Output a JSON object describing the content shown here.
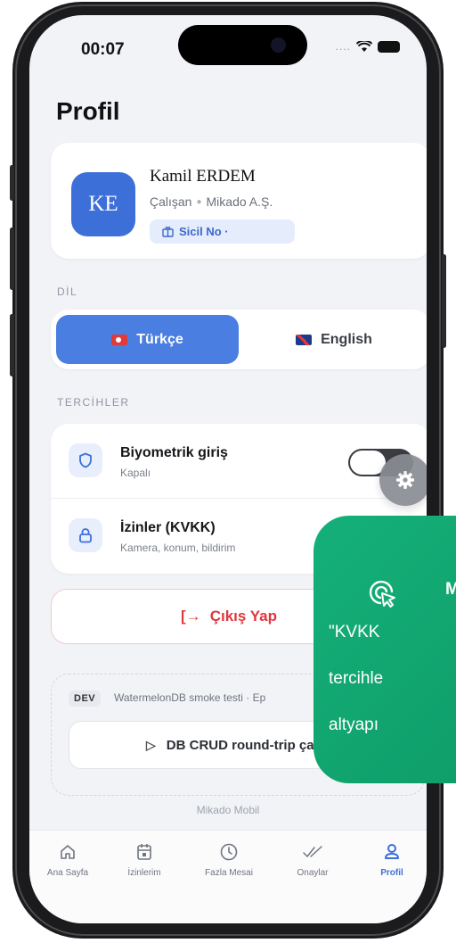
{
  "status": {
    "time": "00:07"
  },
  "page": {
    "title": "Profil"
  },
  "profile": {
    "initials": "KE",
    "name": "Kamil ERDEM",
    "role": "Çalışan",
    "company": "Mikado A.Ş.",
    "sicil_label": "Sicil No ·"
  },
  "language": {
    "section_label": "DİL",
    "options": [
      {
        "label": "Türkçe",
        "selected": true
      },
      {
        "label": "English",
        "selected": false
      }
    ]
  },
  "preferences": {
    "section_label": "TERCİHLER",
    "biometric": {
      "title": "Biyometrik giriş",
      "subtitle": "Kapalı",
      "enabled": false
    },
    "permissions": {
      "title": "İzinler (KVKK)",
      "subtitle": "Kamera, konum, bildirim"
    }
  },
  "logout": {
    "label": "Çıkış Yap"
  },
  "dev": {
    "badge": "DEV",
    "text": "WatermelonDB smoke testi · Ep",
    "button_label": "DB CRUD round-trip ça"
  },
  "footer": {
    "brand": "Mikado Mobil"
  },
  "tabs": [
    {
      "label": "Ana Sayfa",
      "icon": "home-icon",
      "active": false
    },
    {
      "label": "İzinlerim",
      "icon": "calendar-icon",
      "active": false
    },
    {
      "label": "Fazla Mesai",
      "icon": "clock-icon",
      "active": false
    },
    {
      "label": "Onaylar",
      "icon": "double-check-icon",
      "active": false
    },
    {
      "label": "Profil",
      "icon": "user-icon",
      "active": true
    }
  ],
  "toast": {
    "head": "M",
    "lines": [
      "\"KVKK",
      "tercihle",
      "altyapı"
    ]
  },
  "colors": {
    "accent": "#3d6fd9",
    "danger": "#e0363d",
    "toast": "#15b07a"
  }
}
